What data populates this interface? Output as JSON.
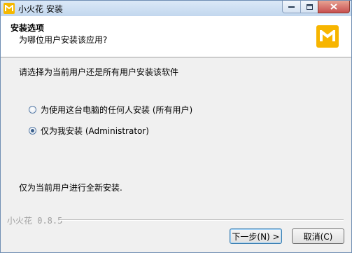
{
  "window": {
    "title": "小火花 安装"
  },
  "header": {
    "title": "安装选项",
    "subtitle": "为哪位用户安装该应用?"
  },
  "body": {
    "instruction": "请选择为当前用户还是所有用户安装该软件",
    "options": [
      {
        "label": "为使用这台电脑的任何人安装 (所有用户)",
        "selected": false
      },
      {
        "label": "仅为我安装 (Administrator)",
        "selected": true
      }
    ],
    "footnote": "仅为当前用户进行全新安装."
  },
  "footer": {
    "branding": "小火花 0.8.5",
    "next_label": "下一步(N) >",
    "cancel_label": "取消(C)"
  },
  "colors": {
    "brand": "#f7b500",
    "close": "#c75050"
  }
}
